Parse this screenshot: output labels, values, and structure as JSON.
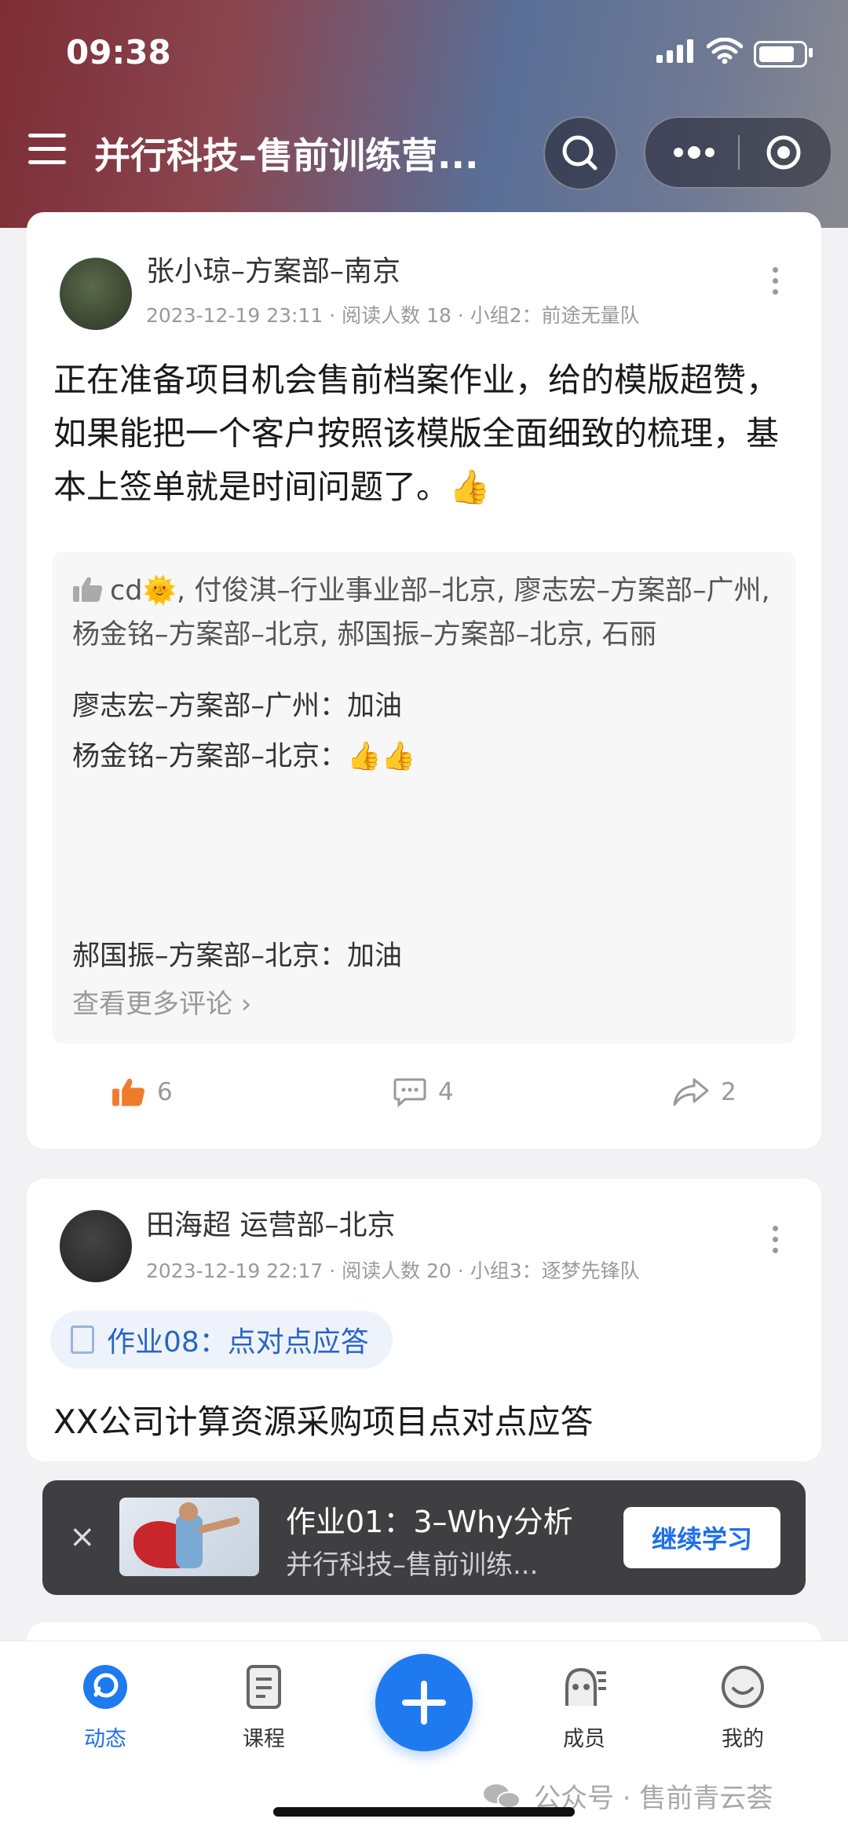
{
  "status": {
    "time": "09:38"
  },
  "nav": {
    "title": "并行科技–售前训练营..."
  },
  "posts": [
    {
      "author": "张小琼–方案部–南京",
      "meta": "2023-12-19 23:11 · 阅读人数 18 · 小组2：前途无量队",
      "text": "正在准备项目机会售前档案作业，给的模版超赞，如果能把一个客户按照该模版全面细致的梳理，基本上签单就是时间问题了。",
      "text_emoji": "👍",
      "likers": "cd🌞, 付俊淇–行业事业部–北京, 廖志宏–方案部–广州, 杨金铭–方案部–北京, 郝国振–方案部–北京, 石丽",
      "comments": [
        {
          "text": "廖志宏–方案部–广州：加油"
        },
        {
          "text": "杨金铭–方案部–北京：👍👍"
        },
        {
          "text": "郝国振–方案部–北京：加油"
        }
      ],
      "more_comments": "查看更多评论 ›",
      "likes": "6",
      "comment_count": "4",
      "shares": "2"
    },
    {
      "author": "田海超 运营部–北京",
      "meta": "2023-12-19 22:17 · 阅读人数 20 · 小组3：逐梦先锋队",
      "tag": "作业08：点对点应答",
      "title": "XX公司计算资源采购项目点对点应答"
    }
  ],
  "mini_player": {
    "close": "×",
    "title": "作业01：3–Why分析",
    "subtitle": "并行科技–售前训练...",
    "button": "继续学习"
  },
  "tabs": [
    {
      "label": "动态",
      "icon": "moments-icon",
      "active": true
    },
    {
      "label": "课程",
      "icon": "course-icon",
      "active": false
    },
    {
      "label": "",
      "icon": "plus-icon",
      "active": false
    },
    {
      "label": "成员",
      "icon": "members-icon",
      "active": false
    },
    {
      "label": "我的",
      "icon": "profile-icon",
      "active": false
    }
  ],
  "watermark": "公众号 · 售前青云荟",
  "colors": {
    "accent": "#1f7af0",
    "like": "#f07b2a"
  }
}
